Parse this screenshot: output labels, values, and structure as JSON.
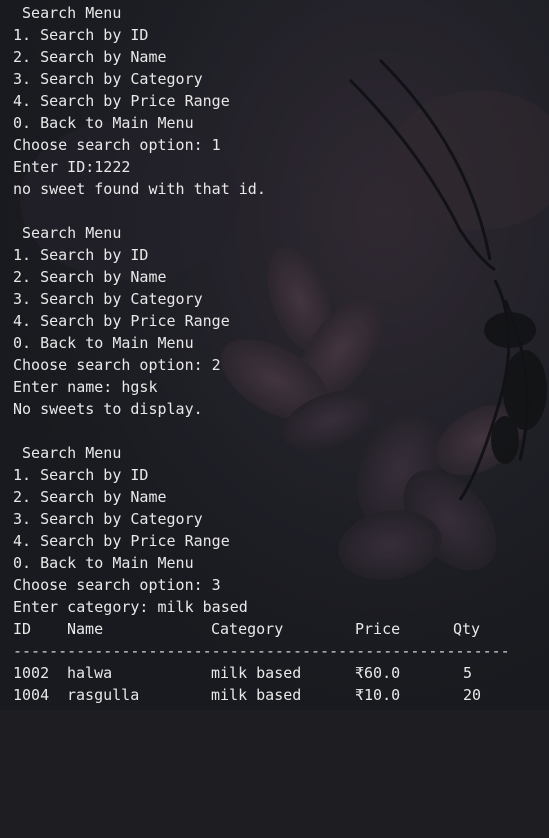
{
  "blocks": [
    {
      "menu_title": " Search Menu",
      "options": [
        "1. Search by ID",
        "2. Search by Name",
        "3. Search by Category",
        "4. Search by Price Range",
        "0. Back to Main Menu"
      ],
      "prompt": "Choose search option: 1",
      "input": "Enter ID:1222",
      "result": "no sweet found with that id."
    },
    {
      "menu_title": " Search Menu",
      "options": [
        "1. Search by ID",
        "2. Search by Name",
        "3. Search by Category",
        "4. Search by Price Range",
        "0. Back to Main Menu"
      ],
      "prompt": "Choose search option: 2",
      "input": "Enter name: hgsk",
      "result": "No sweets to display."
    },
    {
      "menu_title": " Search Menu",
      "options": [
        "1. Search by ID",
        "2. Search by Name",
        "3. Search by Category",
        "4. Search by Price Range",
        "0. Back to Main Menu"
      ],
      "prompt": "Choose search option: 3",
      "input": "Enter category: milk based"
    }
  ],
  "table": {
    "headers": [
      "ID",
      "Name",
      "Category",
      "Price",
      "Qty"
    ],
    "separator": "-------------------------------------------------------",
    "rows": [
      [
        "1002",
        "halwa",
        "milk based",
        "₹60.0",
        "5"
      ],
      [
        "1004",
        "rasgulla",
        "milk based",
        "₹10.0",
        "20"
      ]
    ]
  }
}
